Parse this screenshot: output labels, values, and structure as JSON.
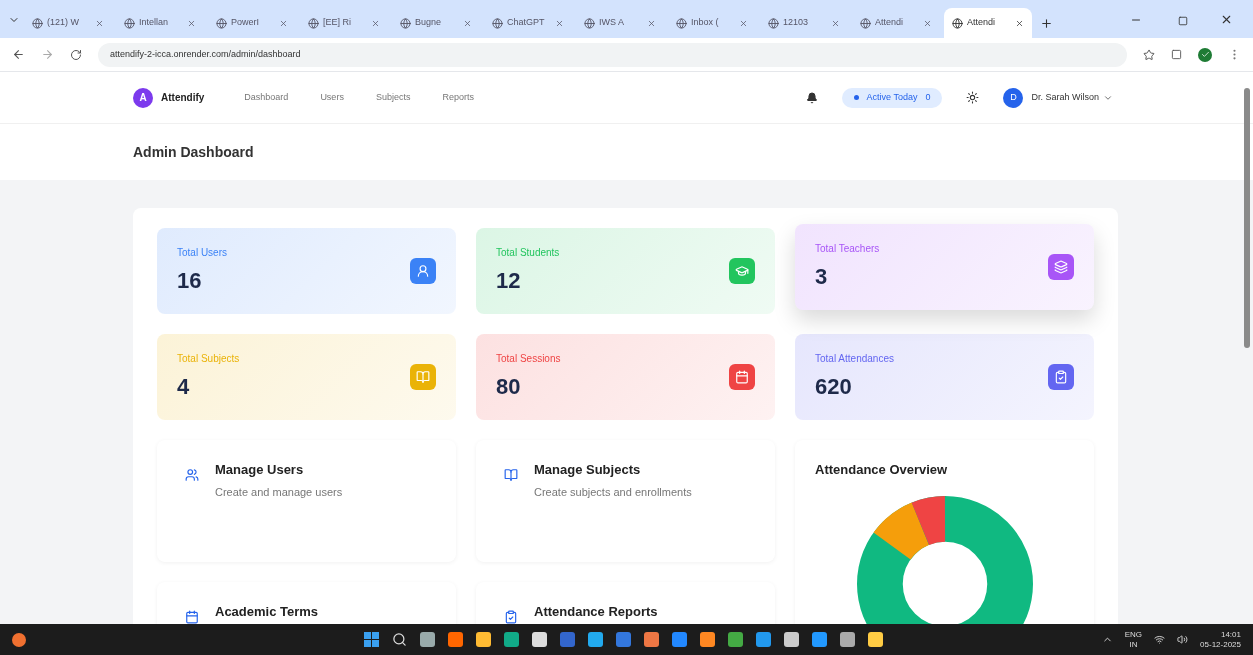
{
  "browser": {
    "tabs": [
      {
        "title": "(121) W",
        "selected": false
      },
      {
        "title": "Intellan",
        "selected": false
      },
      {
        "title": "PowerI",
        "selected": false
      },
      {
        "title": "[EE] Ri",
        "selected": false
      },
      {
        "title": "Bugne",
        "selected": false
      },
      {
        "title": "ChatGPT",
        "selected": false
      },
      {
        "title": "IWS A",
        "selected": false
      },
      {
        "title": "Inbox (",
        "selected": false
      },
      {
        "title": "12103",
        "selected": false
      },
      {
        "title": "Attendi",
        "selected": false
      },
      {
        "title": "Attendi",
        "selected": true
      }
    ],
    "url": "attendify-2-icca.onrender.com/admin/dashboard"
  },
  "app": {
    "brand": {
      "initial": "A",
      "name": "Attendify"
    },
    "nav_links": [
      "Dashboard",
      "Users",
      "Subjects",
      "Reports"
    ],
    "active_today": {
      "label": "Active Today",
      "count": "0"
    },
    "user": {
      "initial": "D",
      "name": "Dr. Sarah Wilson"
    },
    "page_title": "Admin Dashboard",
    "stats": [
      {
        "label": "Total Users",
        "value": "16",
        "color": "#3b82f6",
        "elevated": false
      },
      {
        "label": "Total Students",
        "value": "12",
        "color": "#22c55e",
        "elevated": false
      },
      {
        "label": "Total Teachers",
        "value": "3",
        "color": "#a855f7",
        "elevated": true
      },
      {
        "label": "Total Subjects",
        "value": "4",
        "color": "#eab308",
        "elevated": false
      },
      {
        "label": "Total Sessions",
        "value": "80",
        "color": "#ef4444",
        "elevated": false
      },
      {
        "label": "Total Attendances",
        "value": "620",
        "color": "#6366f1",
        "elevated": false
      }
    ],
    "actions": [
      {
        "title": "Manage Users",
        "description": "Create and manage users"
      },
      {
        "title": "Manage Subjects",
        "description": "Create subjects and enrollments"
      },
      {
        "title": "Academic Terms"
      },
      {
        "title": "Attendance Reports"
      }
    ],
    "chart_card": {
      "title": "Attendance Overview"
    }
  },
  "taskbar": {
    "language": "ENG",
    "region": "IN",
    "time": "14:01",
    "date": "05-12-2025"
  }
}
